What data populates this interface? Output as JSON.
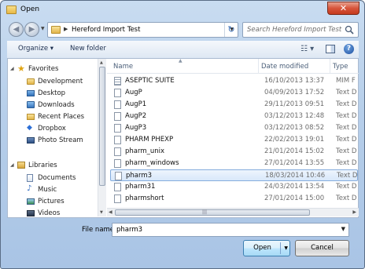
{
  "window": {
    "title": "Open",
    "close_glyph": "✕"
  },
  "address": {
    "path": "Hereford Import Test",
    "arrow": "▶"
  },
  "search": {
    "placeholder": "Search Hereford Import Test"
  },
  "toolbar": {
    "organize": "Organize ▾",
    "new_folder": "New folder",
    "help": "?"
  },
  "nav": {
    "favorites": "Favorites",
    "favorite_items": [
      "Development",
      "Desktop",
      "Downloads",
      "Recent Places",
      "Dropbox",
      "Photo Stream"
    ],
    "libraries": "Libraries",
    "library_items": [
      "Documents",
      "Music",
      "Pictures",
      "Videos"
    ]
  },
  "columns": {
    "name": "Name",
    "date": "Date modified",
    "type": "Type"
  },
  "files": [
    {
      "name": "ASEPTIC SUITE",
      "date": "16/10/2013 13:37",
      "type": "MIM F"
    },
    {
      "name": "AugP",
      "date": "04/09/2013 17:52",
      "type": "Text D"
    },
    {
      "name": "AugP1",
      "date": "29/11/2013 09:51",
      "type": "Text D"
    },
    {
      "name": "AugP2",
      "date": "03/12/2013 12:48",
      "type": "Text D"
    },
    {
      "name": "AugP3",
      "date": "03/12/2013 08:52",
      "type": "Text D"
    },
    {
      "name": "PHARM PHEXP",
      "date": "22/02/2013 19:01",
      "type": "Text D"
    },
    {
      "name": "pharm_unix",
      "date": "21/01/2014 15:02",
      "type": "Text D"
    },
    {
      "name": "pharm_windows",
      "date": "27/01/2014 13:55",
      "type": "Text D"
    },
    {
      "name": "pharm3",
      "date": "18/03/2014 10:46",
      "type": "Text D"
    },
    {
      "name": "pharm31",
      "date": "24/03/2014 13:54",
      "type": "Text D"
    },
    {
      "name": "pharmshort",
      "date": "27/01/2014 15:00",
      "type": "Text D"
    }
  ],
  "selected_file": "pharm3",
  "filename": {
    "label": "File name:",
    "value": "pharm3"
  },
  "buttons": {
    "open": "Open",
    "cancel": "Cancel"
  }
}
